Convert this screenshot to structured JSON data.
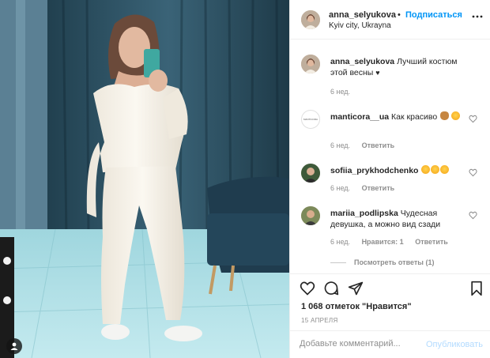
{
  "post": {
    "username": "anna_selyukova",
    "follow_label": "Подписаться",
    "separator": "•",
    "location": "Kyiv city, Ukrayna"
  },
  "caption": {
    "username": "anna_selyukova",
    "text": "Лучший костюм этой весны",
    "heart": "♥",
    "time": "6 нед."
  },
  "comments": [
    {
      "username": "manticora__ua",
      "text": "Как красиво",
      "time": "6 нед.",
      "reply": "Ответить",
      "avatar_text": "MANTICORA"
    },
    {
      "username": "sofiia_prykhodchenko",
      "text": "",
      "time": "6 нед.",
      "reply": "Ответить"
    },
    {
      "username": "mariia_podlipska",
      "text": "Чудесная девушка, а можно вид сзади",
      "time": "6 нед.",
      "likes": "Нравится: 1",
      "reply": "Ответить"
    }
  ],
  "view_replies": "Посмотреть ответы (1)",
  "likes_text": "1 068 отметок \"Нравится\"",
  "date": "15 АПРЕЛЯ",
  "add_comment": {
    "placeholder": "Добавьте комментарий...",
    "post_label": "Опубликовать"
  },
  "colors": {
    "link_blue": "#0095f6",
    "disabled_blue": "#b3dbff",
    "muted_gray": "#8e8e8e",
    "text": "#262626",
    "divider": "#efefef"
  },
  "icons": [
    "more-icon",
    "heart-icon",
    "comment-icon",
    "share-icon",
    "bookmark-icon",
    "emoji-icons"
  ]
}
